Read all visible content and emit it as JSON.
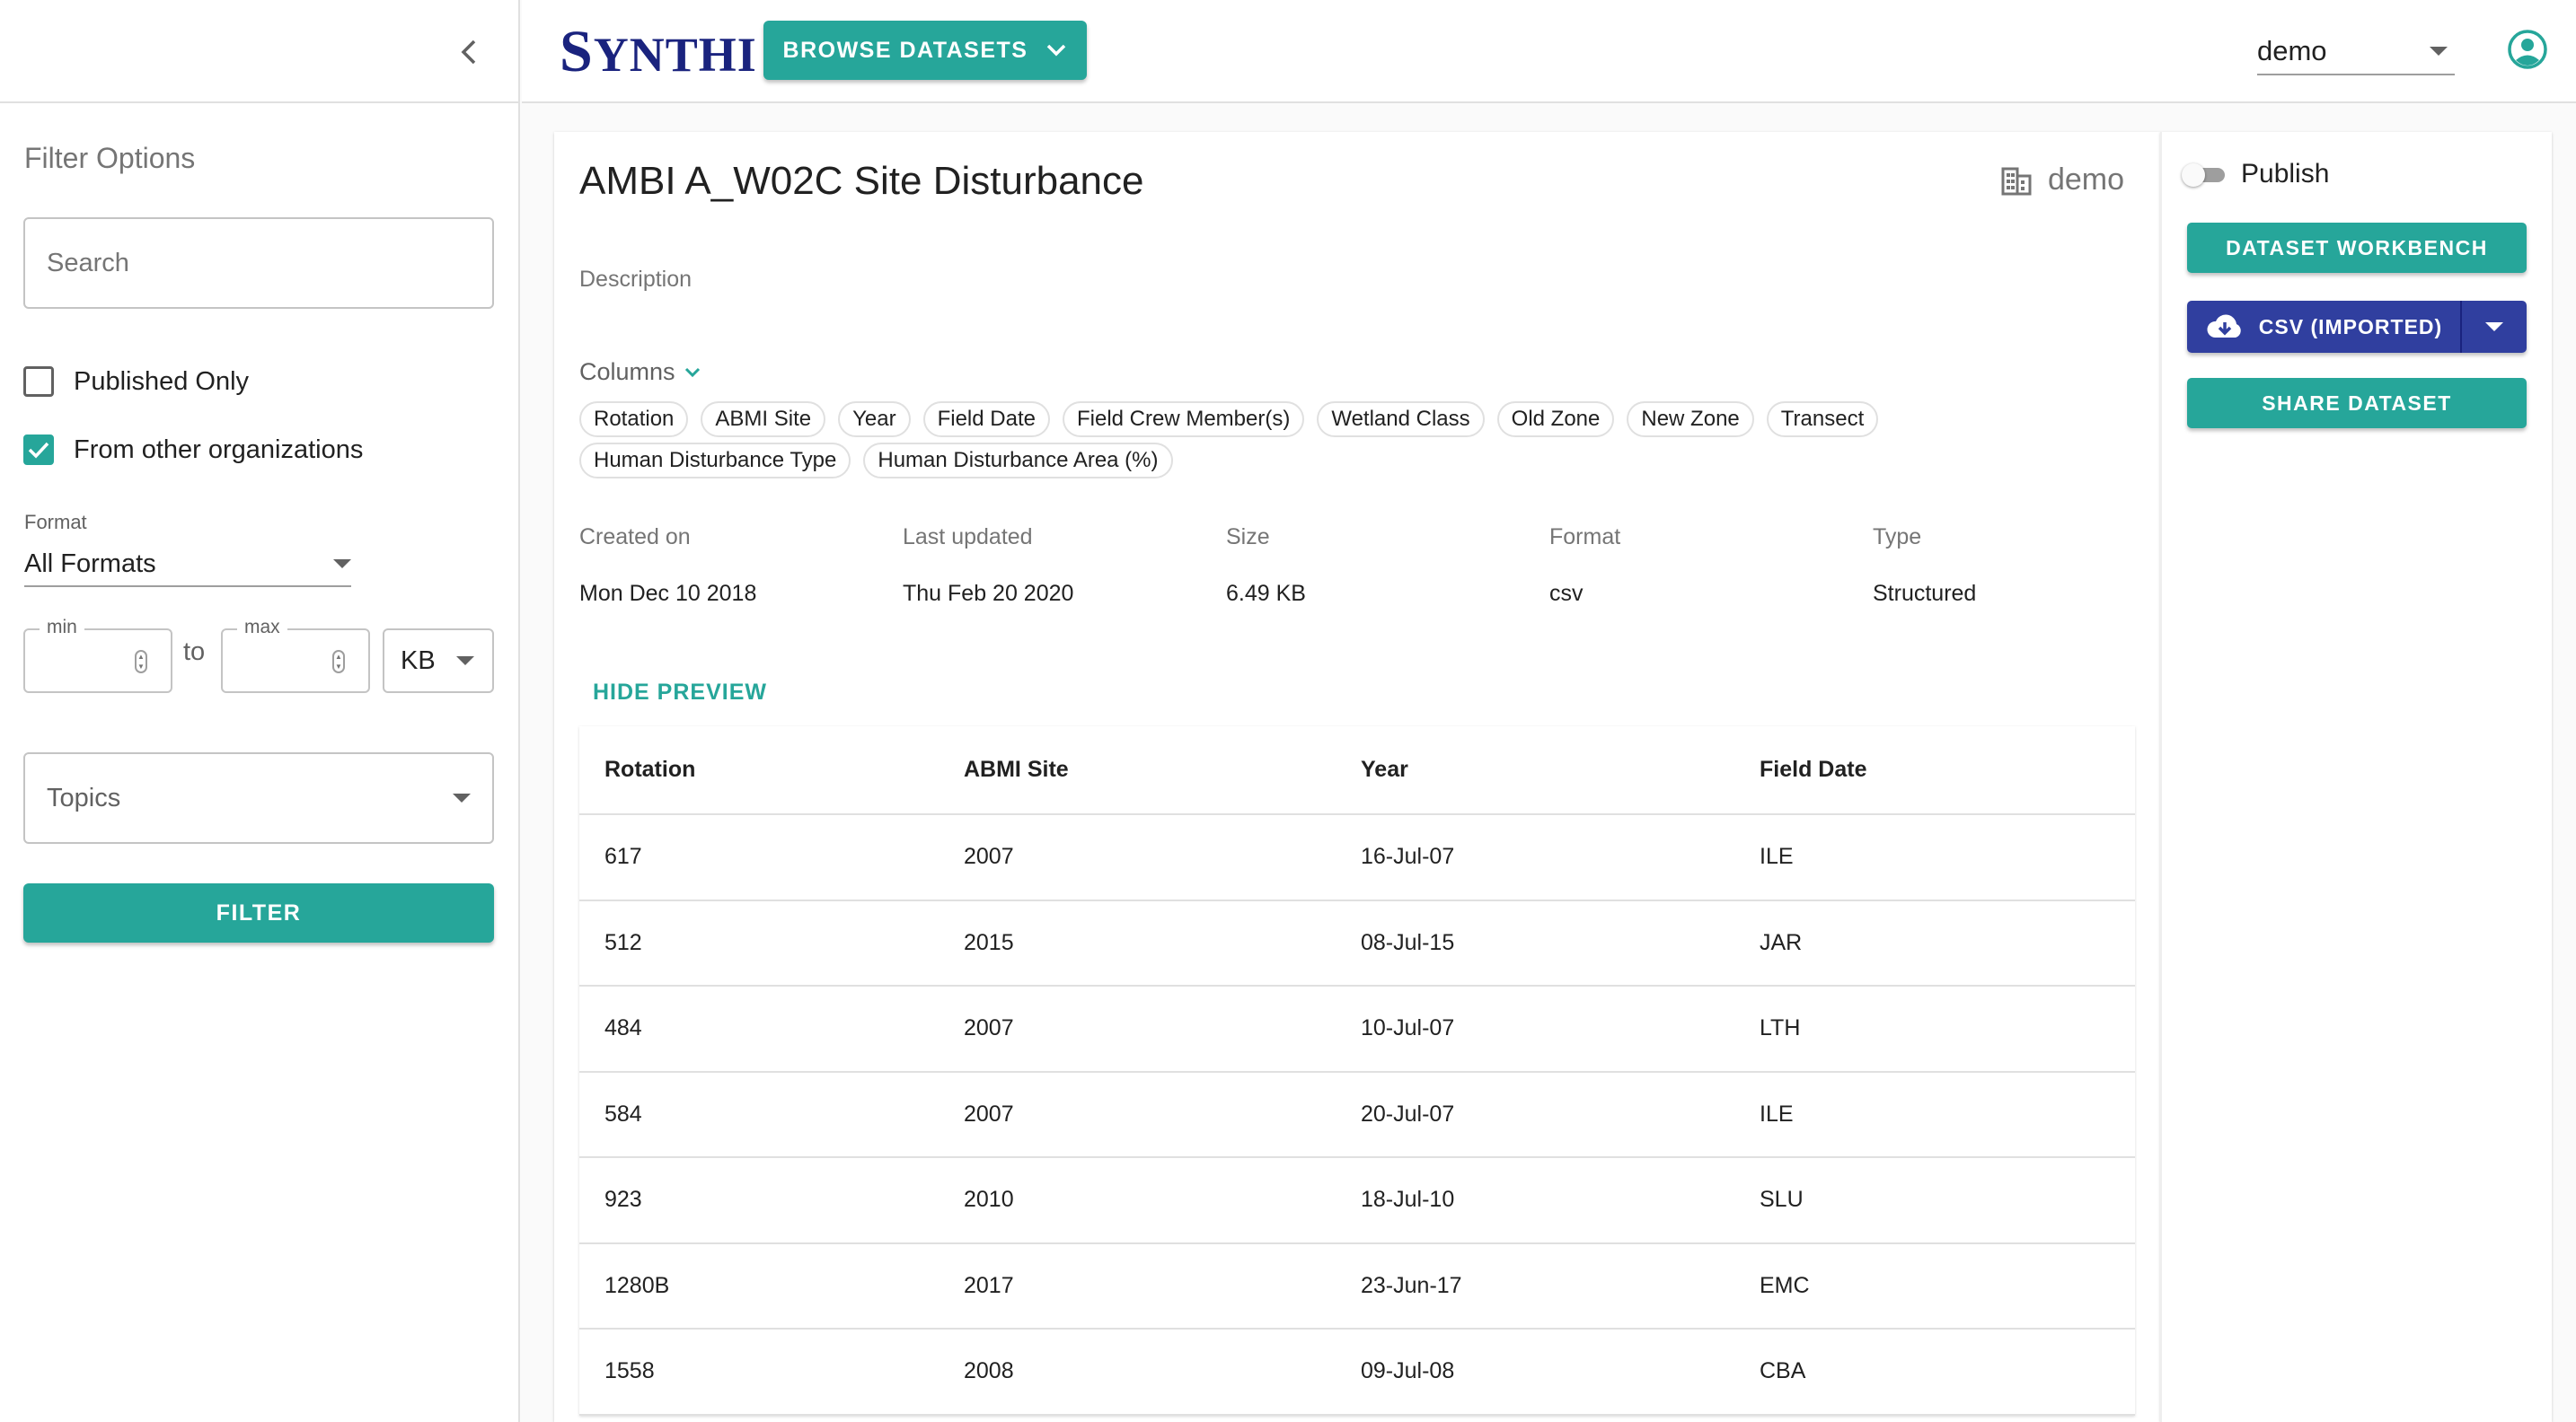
{
  "colors": {
    "accent": "#26a69a",
    "brand": "#1a237e",
    "csv_button": "#303f9f"
  },
  "sidebar": {
    "collapse_icon": "chevron-left-icon",
    "filter_title": "Filter Options",
    "search_placeholder": "Search",
    "published_only_label": "Published Only",
    "published_only_checked": false,
    "other_orgs_label": "From other organizations",
    "other_orgs_checked": true,
    "format_label": "Format",
    "format_value": "All Formats",
    "size_min_label": "min",
    "size_max_label": "max",
    "size_to_label": "to",
    "size_unit": "KB",
    "topics_placeholder": "Topics",
    "filter_button": "FILTER"
  },
  "header": {
    "logo_first": "S",
    "logo_rest": "YNTHI",
    "browse_button": "BROWSE DATASETS",
    "user": "demo",
    "account_icon": "account-circle-icon"
  },
  "dataset": {
    "title": "AMBI A_W02C Site Disturbance",
    "owner": "demo",
    "owner_icon": "building-icon",
    "description_label": "Description",
    "columns_label": "Columns",
    "columns": [
      "Rotation",
      "ABMI Site",
      "Year",
      "Field Date",
      "Field Crew Member(s)",
      "Wetland Class",
      "Old Zone",
      "New Zone",
      "Transect",
      "Human Disturbance Type",
      "Human Disturbance Area (%)"
    ],
    "meta": [
      {
        "label": "Created on",
        "value": "Mon Dec 10 2018"
      },
      {
        "label": "Last updated",
        "value": "Thu Feb 20 2020"
      },
      {
        "label": "Size",
        "value": "6.49 KB"
      },
      {
        "label": "Format",
        "value": "csv"
      },
      {
        "label": "Type",
        "value": "Structured"
      }
    ],
    "hide_preview": "HIDE PREVIEW"
  },
  "preview": {
    "headers": [
      "Rotation",
      "ABMI Site",
      "Year",
      "Field Date"
    ],
    "rows": [
      [
        "617",
        "2007",
        "16-Jul-07",
        "ILE"
      ],
      [
        "512",
        "2015",
        "08-Jul-15",
        "JAR"
      ],
      [
        "484",
        "2007",
        "10-Jul-07",
        "LTH"
      ],
      [
        "584",
        "2007",
        "20-Jul-07",
        "ILE"
      ],
      [
        "923",
        "2010",
        "18-Jul-10",
        "SLU"
      ],
      [
        "1280B",
        "2017",
        "23-Jun-17",
        "EMC"
      ],
      [
        "1558",
        "2008",
        "09-Jul-08",
        "CBA"
      ]
    ]
  },
  "actions": {
    "publish_label": "Publish",
    "publish_on": false,
    "workbench": "DATASET WORKBENCH",
    "csv": "CSV (IMPORTED)",
    "csv_icon": "cloud-download-icon",
    "share": "SHARE DATASET"
  }
}
